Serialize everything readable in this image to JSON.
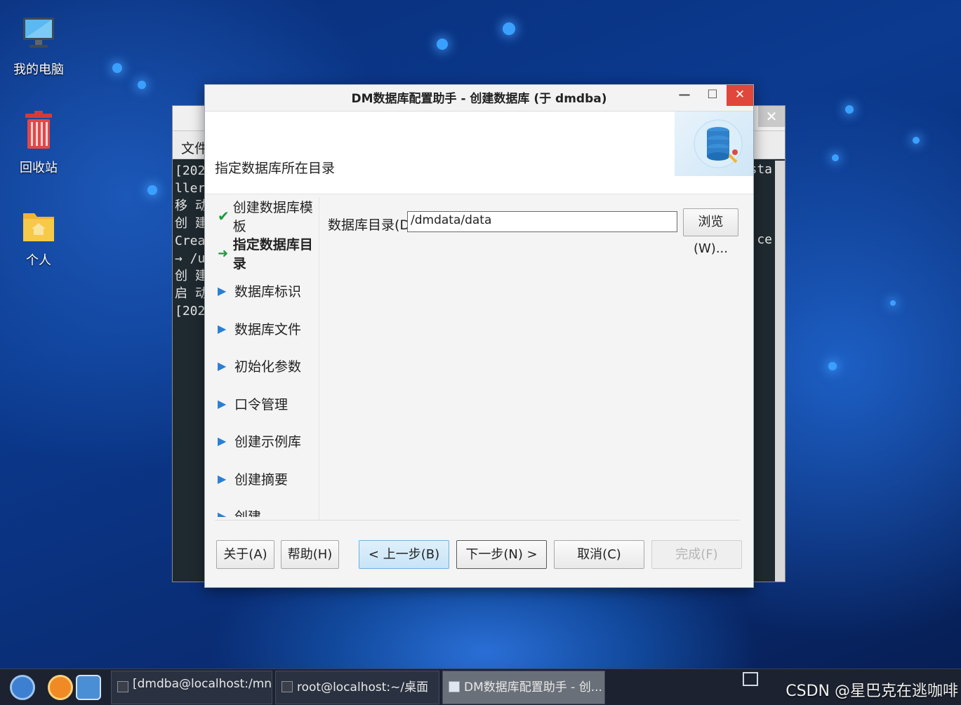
{
  "desktop": {
    "icons": [
      {
        "label": "我的电脑"
      },
      {
        "label": "回收站"
      },
      {
        "label": "个人"
      }
    ]
  },
  "terminal": {
    "menu_file": "文件",
    "lines": [
      "[202",
      "ller",
      "移 动",
      "创 建",
      "Crea",
      "→ /u",
      "创 建",
      "启 动",
      "[202"
    ],
    "right_text_1": "sta",
    "right_text_2": "ce"
  },
  "dialog": {
    "title": "DM数据库配置助手 - 创建数据库 (于 dmdba)",
    "header_title": "指定数据库所在目录",
    "nav": [
      {
        "label": "创建数据库模板",
        "state": "done"
      },
      {
        "label": "指定数据库目录",
        "state": "active"
      },
      {
        "label": "数据库标识",
        "state": "pending"
      },
      {
        "label": "数据库文件",
        "state": "pending"
      },
      {
        "label": "初始化参数",
        "state": "pending"
      },
      {
        "label": "口令管理",
        "state": "pending"
      },
      {
        "label": "创建示例库",
        "state": "pending"
      },
      {
        "label": "创建摘要",
        "state": "pending"
      },
      {
        "label": "创建",
        "state": "pending"
      }
    ],
    "dir_label": "数据库目录(D):",
    "dir_value": "/dmdata/data",
    "browse_label": "浏览(W)...",
    "buttons": {
      "about": "关于(A)",
      "help": "帮助(H)",
      "prev": "< 上一步(B)",
      "next": "下一步(N) >",
      "cancel": "取消(C)",
      "finish": "完成(F)"
    }
  },
  "taskbar": {
    "tasks": [
      {
        "label": "[dmdba@localhost:/mnt]"
      },
      {
        "label": "root@localhost:~/桌面"
      },
      {
        "label": "DM数据库配置助手 - 创..."
      }
    ],
    "watermark": "CSDN @星巴克在逃咖啡"
  },
  "colors": {
    "close_button": "#e0463a",
    "primary_button": "#c7e4f7",
    "check_green": "#1b9a3a",
    "arrow_blue": "#2a7fd4"
  }
}
